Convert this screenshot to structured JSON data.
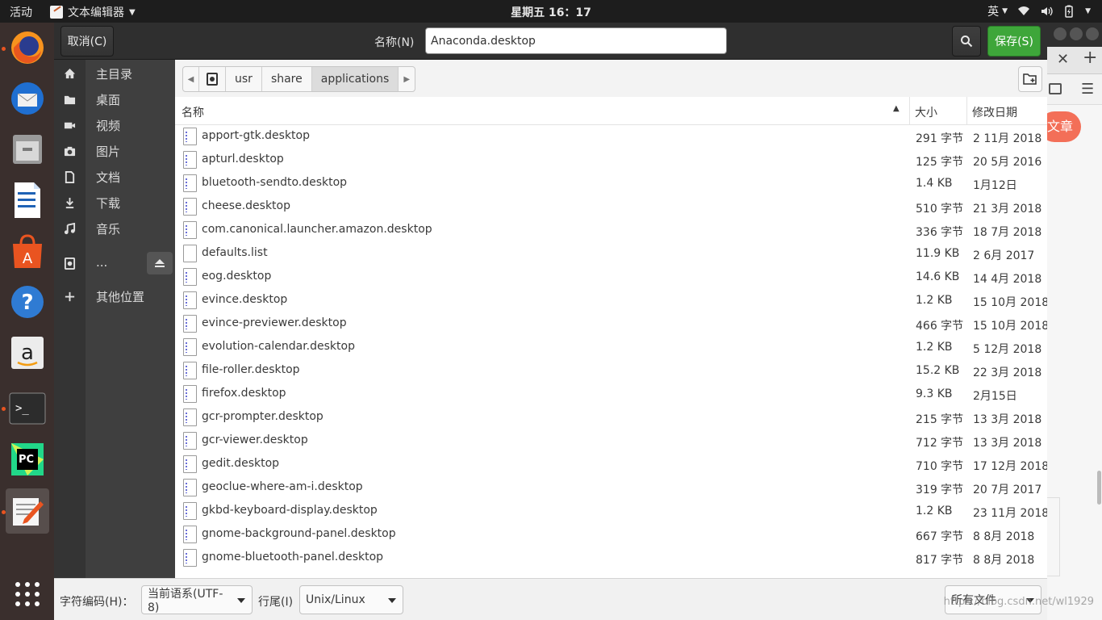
{
  "topbar": {
    "activities": "活动",
    "app_name": "文本编辑器",
    "clock": "星期五 16：17",
    "input_method": "英"
  },
  "dialog": {
    "cancel_label": "取消(C)",
    "name_label": "名称(N)",
    "filename": "Anaconda.desktop",
    "save_label": "保存(S)"
  },
  "sidebar": {
    "items": [
      {
        "label": "主目录",
        "icon": "home-icon"
      },
      {
        "label": "桌面",
        "icon": "folder-icon"
      },
      {
        "label": "视频",
        "icon": "video-icon"
      },
      {
        "label": "图片",
        "icon": "camera-icon"
      },
      {
        "label": "文档",
        "icon": "document-icon"
      },
      {
        "label": "下载",
        "icon": "download-icon"
      },
      {
        "label": "音乐",
        "icon": "music-icon"
      },
      {
        "label": "...",
        "icon": "drive-icon"
      },
      {
        "label": "其他位置",
        "icon": "plus-icon"
      }
    ]
  },
  "pathbar": {
    "crumbs": [
      "usr",
      "share",
      "applications"
    ]
  },
  "list": {
    "headers": {
      "name": "名称",
      "size": "大小",
      "date": "修改日期"
    },
    "rows": [
      {
        "name": "apport-gtk.desktop",
        "size": "291 字节",
        "date": "2 11月 2018"
      },
      {
        "name": "apturl.desktop",
        "size": "125 字节",
        "date": "20 5月 2016"
      },
      {
        "name": "bluetooth-sendto.desktop",
        "size": "1.4 KB",
        "date": "1月12日"
      },
      {
        "name": "cheese.desktop",
        "size": "510 字节",
        "date": "21 3月 2018"
      },
      {
        "name": "com.canonical.launcher.amazon.desktop",
        "size": "336 字节",
        "date": "18 7月 2018"
      },
      {
        "name": "defaults.list",
        "size": "11.9 KB",
        "date": "2 6月 2017"
      },
      {
        "name": "eog.desktop",
        "size": "14.6 KB",
        "date": "14 4月 2018"
      },
      {
        "name": "evince.desktop",
        "size": "1.2 KB",
        "date": "15 10月 2018"
      },
      {
        "name": "evince-previewer.desktop",
        "size": "466 字节",
        "date": "15 10月 2018"
      },
      {
        "name": "evolution-calendar.desktop",
        "size": "1.2 KB",
        "date": "5 12月 2018"
      },
      {
        "name": "file-roller.desktop",
        "size": "15.2 KB",
        "date": "22 3月 2018"
      },
      {
        "name": "firefox.desktop",
        "size": "9.3 KB",
        "date": "2月15日"
      },
      {
        "name": "gcr-prompter.desktop",
        "size": "215 字节",
        "date": "13 3月 2018"
      },
      {
        "name": "gcr-viewer.desktop",
        "size": "712 字节",
        "date": "13 3月 2018"
      },
      {
        "name": "gedit.desktop",
        "size": "710 字节",
        "date": "17 12月 2018"
      },
      {
        "name": "geoclue-where-am-i.desktop",
        "size": "319 字节",
        "date": "20 7月 2017"
      },
      {
        "name": "gkbd-keyboard-display.desktop",
        "size": "1.2 KB",
        "date": "23 11月 2018"
      },
      {
        "name": "gnome-background-panel.desktop",
        "size": "667 字节",
        "date": "8 8月 2018"
      },
      {
        "name": "gnome-bluetooth-panel.desktop",
        "size": "817 字节",
        "date": "8 8月 2018"
      }
    ]
  },
  "footer": {
    "encoding_label": "字符编码(H)：",
    "encoding_value": "当前语系(UTF-8)",
    "lineend_label": "行尾(I)",
    "lineend_value": "Unix/Linux",
    "filter_value": "所有文件"
  },
  "background_window": {
    "button_text": "文章"
  },
  "watermark": "https://blog.csdn.net/wl1929",
  "colors": {
    "save_green": "#3ea63a",
    "dock_bg": "#3a2f2d",
    "sidebar_bg": "#3f3f3f",
    "accent_orange": "#e95420"
  }
}
